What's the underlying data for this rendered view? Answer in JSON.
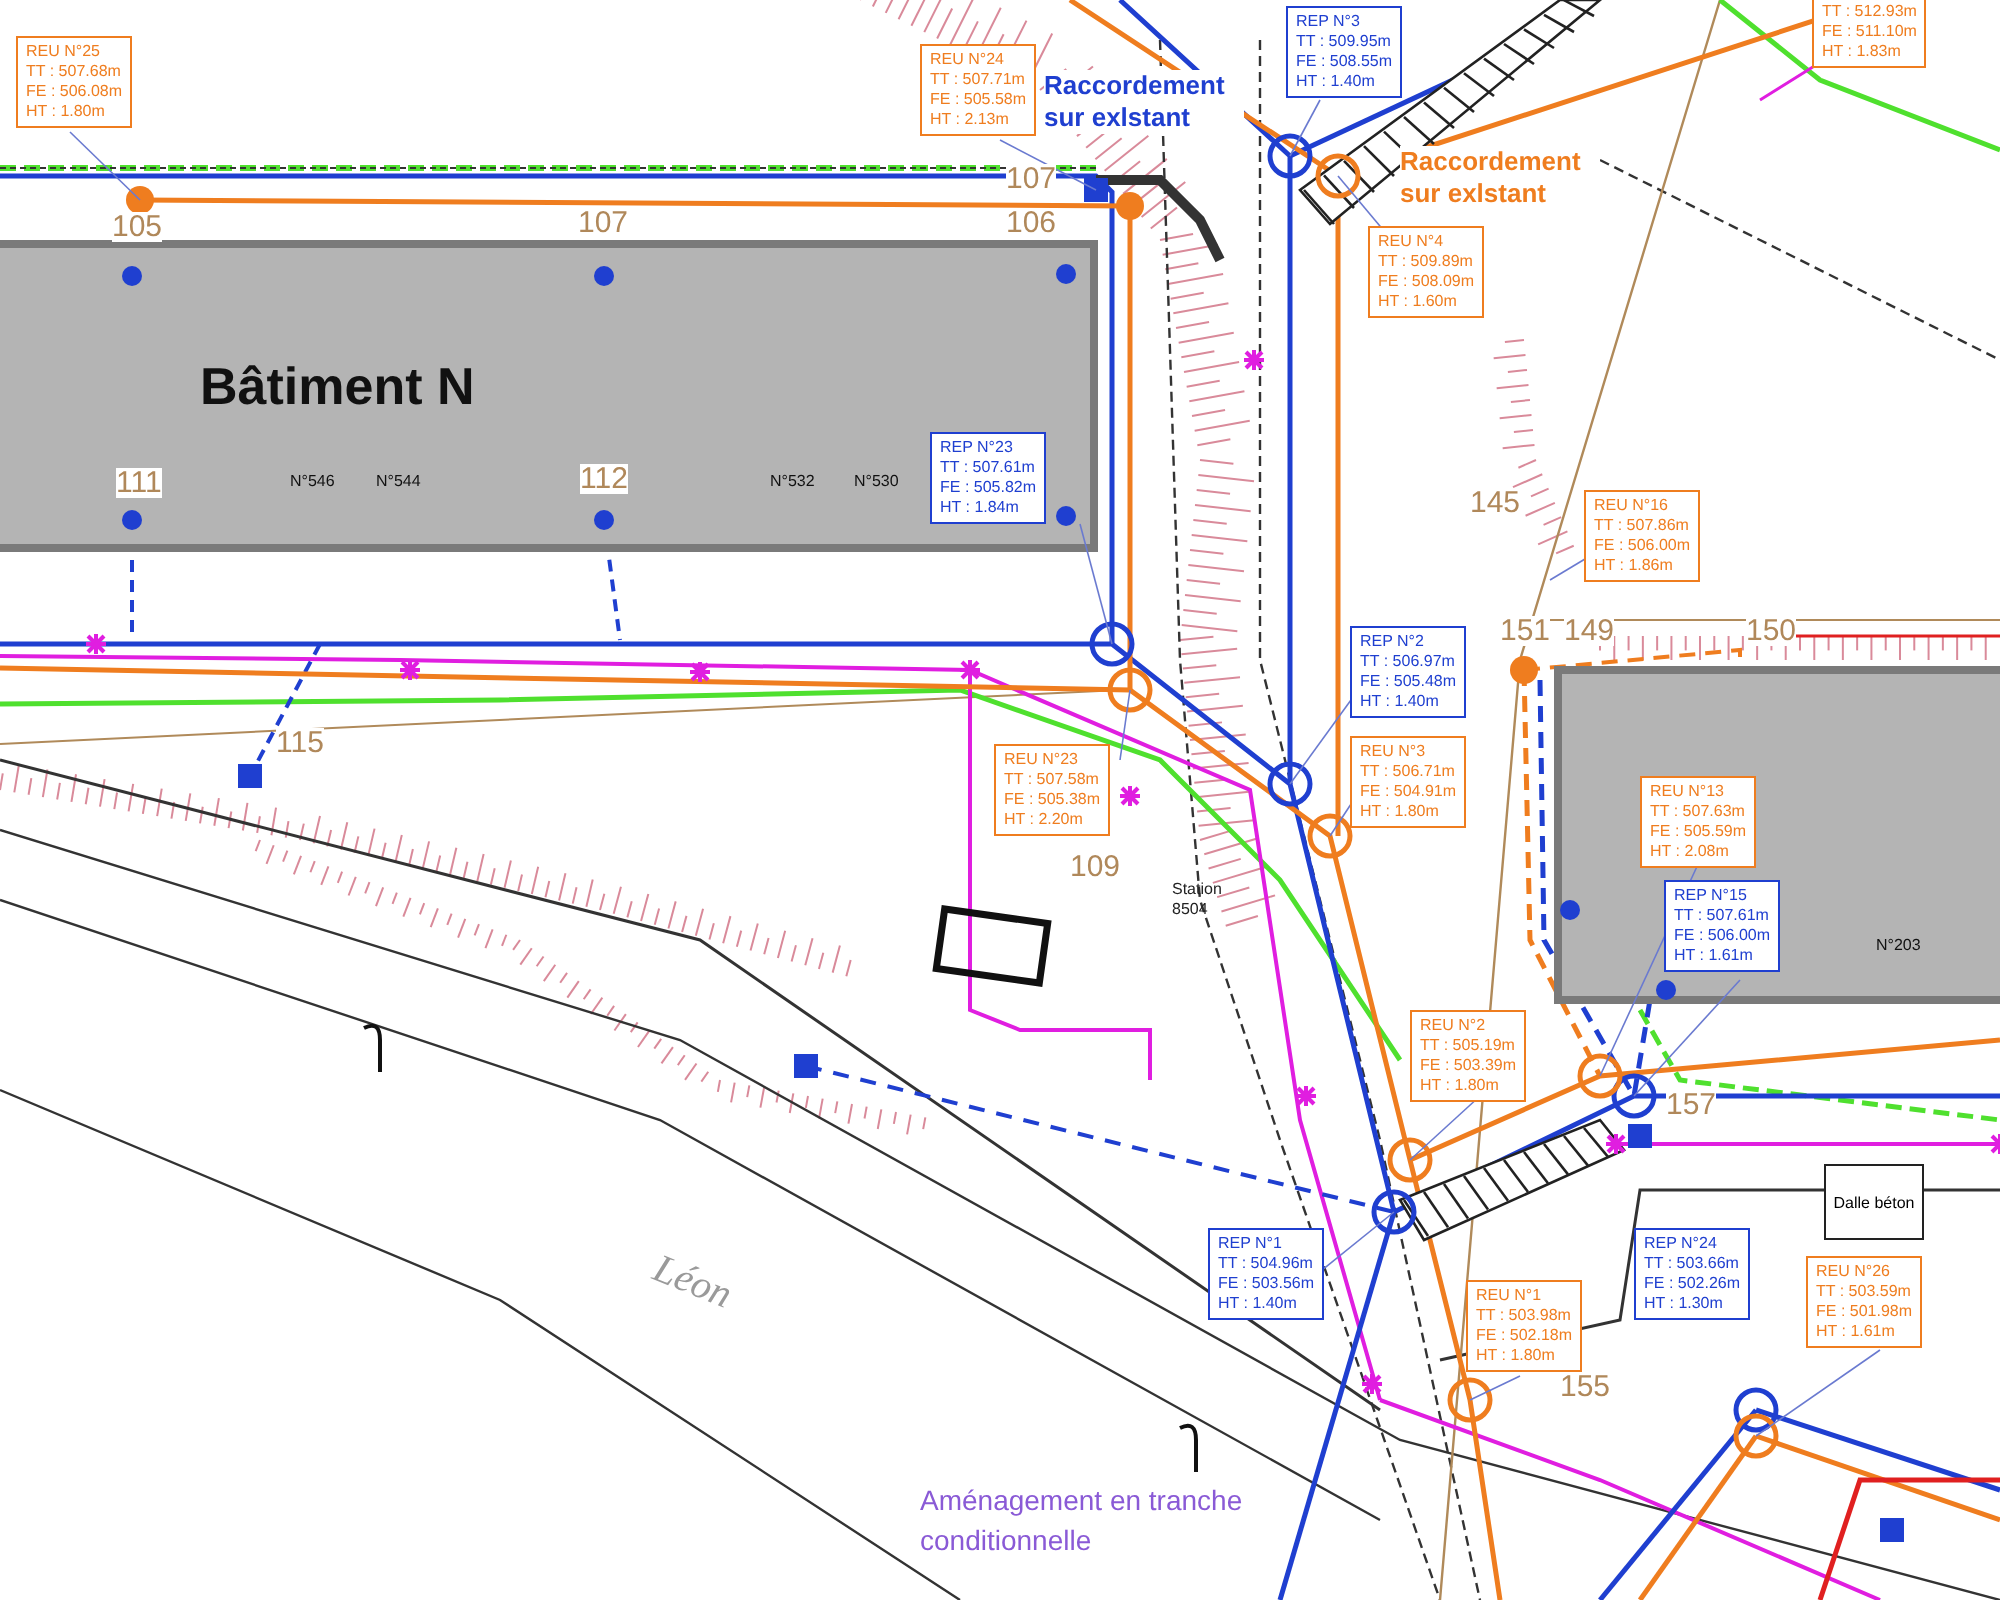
{
  "buildings": [
    {
      "name": "Bâtiment N",
      "numbers": [
        "N°546",
        "N°544",
        "N°532",
        "N°530"
      ]
    },
    {
      "numbers": [
        "N°203"
      ]
    }
  ],
  "connections": [
    {
      "kind": "rep",
      "label": "Raccordement sur exlstant"
    },
    {
      "kind": "reu",
      "label": "Raccordement sur exlstant"
    }
  ],
  "lot_numbers": [
    "105",
    "107",
    "107",
    "106",
    "111",
    "112",
    "145",
    "151",
    "149",
    "150",
    "115",
    "109",
    "157",
    "155"
  ],
  "callouts": [
    {
      "kind": "reu",
      "title": "REU N°25",
      "tt": "TT : 507.68m",
      "fe": "FE : 506.08m",
      "ht": "HT : 1.80m"
    },
    {
      "kind": "reu",
      "title": "REU N°24",
      "tt": "TT : 507.71m",
      "fe": "FE : 505.58m",
      "ht": "HT : 2.13m"
    },
    {
      "kind": "rep",
      "title": "REP N°3",
      "tt": "TT : 509.95m",
      "fe": "FE : 508.55m",
      "ht": "HT : 1.40m"
    },
    {
      "kind": "reu",
      "tt": "TT : 512.93m",
      "fe": "FE : 511.10m",
      "ht": "HT : 1.83m"
    },
    {
      "kind": "reu",
      "title": "REU N°4",
      "tt": "TT : 509.89m",
      "fe": "FE : 508.09m",
      "ht": "HT : 1.60m"
    },
    {
      "kind": "rep",
      "title": "REP N°23",
      "tt": "TT : 507.61m",
      "fe": "FE : 505.82m",
      "ht": "HT : 1.84m"
    },
    {
      "kind": "reu",
      "title": "REU N°16",
      "tt": "TT : 507.86m",
      "fe": "FE : 506.00m",
      "ht": "HT : 1.86m"
    },
    {
      "kind": "rep",
      "title": "REP N°2",
      "tt": "TT : 506.97m",
      "fe": "FE : 505.48m",
      "ht": "HT : 1.40m"
    },
    {
      "kind": "reu",
      "title": "REU N°23",
      "tt": "TT : 507.58m",
      "fe": "FE : 505.38m",
      "ht": "HT : 2.20m"
    },
    {
      "kind": "reu",
      "title": "REU N°3",
      "tt": "TT : 506.71m",
      "fe": "FE : 504.91m",
      "ht": "HT : 1.80m"
    },
    {
      "kind": "reu",
      "title": "REU N°13",
      "tt": "TT : 507.63m",
      "fe": "FE : 505.59m",
      "ht": "HT : 2.08m"
    },
    {
      "kind": "rep",
      "title": "REP N°15",
      "tt": "TT : 507.61m",
      "fe": "FE : 506.00m",
      "ht": "HT : 1.61m"
    },
    {
      "kind": "reu",
      "title": "REU N°2",
      "tt": "TT : 505.19m",
      "fe": "FE : 503.39m",
      "ht": "HT : 1.80m"
    },
    {
      "kind": "rep",
      "title": "REP N°1",
      "tt": "TT : 504.96m",
      "fe": "FE : 503.56m",
      "ht": "HT : 1.40m"
    },
    {
      "kind": "rep",
      "title": "REP N°24",
      "tt": "TT : 503.66m",
      "fe": "FE : 502.26m",
      "ht": "HT : 1.30m"
    },
    {
      "kind": "reu",
      "title": "REU N°1",
      "tt": "TT : 503.98m",
      "fe": "FE : 502.18m",
      "ht": "HT : 1.80m"
    },
    {
      "kind": "reu",
      "title": "REU N°26",
      "tt": "TT : 503.59m",
      "fe": "FE : 501.98m",
      "ht": "HT : 1.61m"
    }
  ],
  "station": "Station 8504",
  "slab": "Dalle béton",
  "street": "Léon",
  "note": "Aménagement en tranche conditionnelle"
}
